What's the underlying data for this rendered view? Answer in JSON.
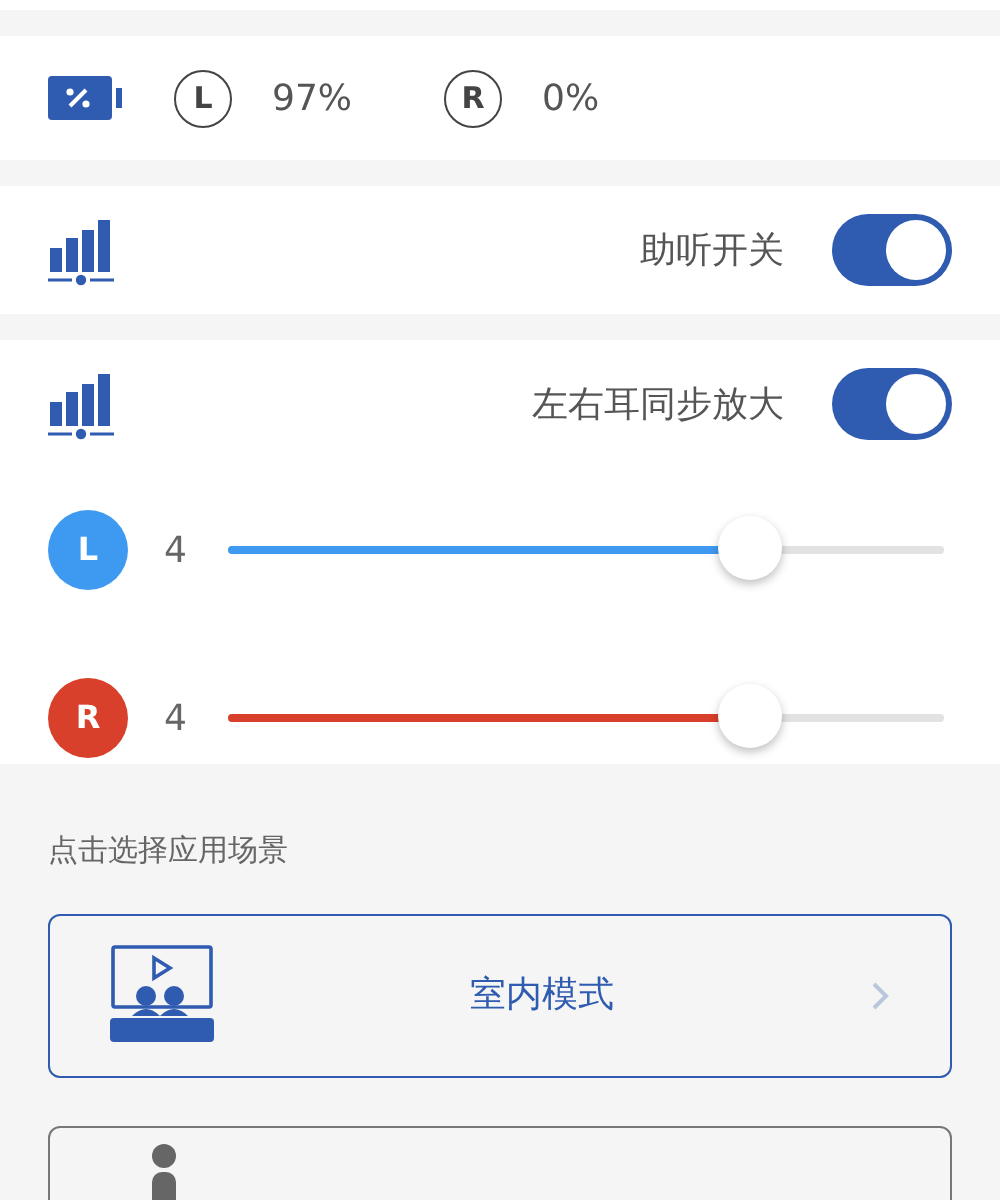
{
  "battery": {
    "left": {
      "side": "L",
      "reading": "97%"
    },
    "right": {
      "side": "R",
      "reading": "0%"
    }
  },
  "switches": [
    {
      "label": "助听开关",
      "on": true
    },
    {
      "label": "左右耳同步放大",
      "on": true
    }
  ],
  "volume": [
    {
      "side": "L",
      "reading": "4",
      "level": 0.73,
      "color": "#3d9af0"
    },
    {
      "side": "R",
      "reading": "4",
      "level": 0.73,
      "color": "#d9402b"
    }
  ],
  "scenes": {
    "heading": "点击选择应用场景",
    "items": [
      {
        "kind": "theater",
        "label": "室内模式",
        "selected": true
      },
      {
        "kind": "person",
        "selected": false
      }
    ]
  }
}
